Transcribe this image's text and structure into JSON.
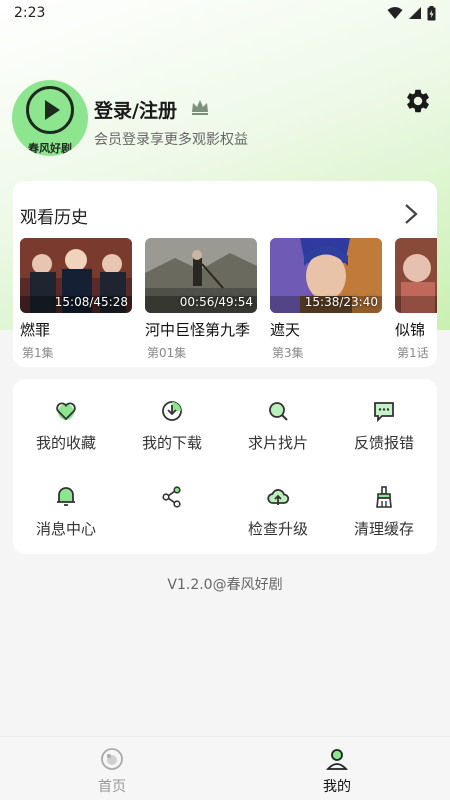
{
  "status_bar": {
    "time": "2:23"
  },
  "profile": {
    "brand_text": "春风好剧",
    "login_title": "登录/注册",
    "subtitle": "会员登录享更多观影权益"
  },
  "history": {
    "title": "观看历史",
    "items": [
      {
        "name": "燃罪",
        "episode": "第1集",
        "progress": "15:08/45:28"
      },
      {
        "name": "河中巨怪第九季",
        "episode": "第01集",
        "progress": "00:56/49:54"
      },
      {
        "name": "遮天",
        "episode": "第3集",
        "progress": "15:38/23:40"
      },
      {
        "name": "似锦",
        "episode": "第1话",
        "progress": ""
      }
    ]
  },
  "menu": {
    "items": [
      {
        "label": "我的收藏",
        "icon": "heart-icon"
      },
      {
        "label": "我的下载",
        "icon": "download-icon"
      },
      {
        "label": "求片找片",
        "icon": "search-film-icon"
      },
      {
        "label": "反馈报错",
        "icon": "feedback-icon"
      },
      {
        "label": "消息中心",
        "icon": "bell-icon"
      },
      {
        "label": "",
        "icon": "share-icon"
      },
      {
        "label": "检查升级",
        "icon": "cloud-upload-icon"
      },
      {
        "label": "清理缓存",
        "icon": "broom-icon"
      }
    ]
  },
  "version": "V1.2.0@春风好剧",
  "bottom_nav": {
    "home": "首页",
    "mine": "我的"
  },
  "colors": {
    "accent_green": "#8ee58f",
    "icon_dark": "#333333",
    "nav_inactive": "#999999",
    "nav_active": "#111111"
  }
}
